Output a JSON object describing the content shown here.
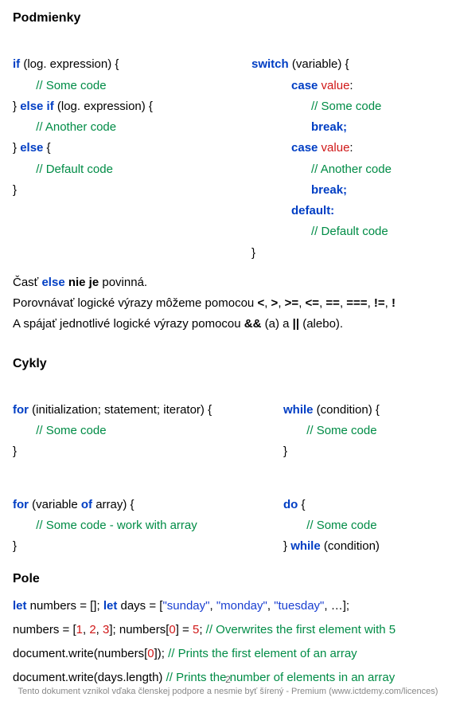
{
  "h_conditions": "Podmienky",
  "if_kw1": "if",
  "if_t1": " (log. expression) {",
  "if_c1": "// Some code",
  "if_kw2": "else if",
  "if_t2a": "} ",
  "if_t2b": " (log. expression) {",
  "if_c2": "// Another code",
  "if_t3a": "} ",
  "if_kw3": "else",
  "if_t3b": " {",
  "if_c3": "// Default code",
  "if_t4": "}",
  "sw_kw": "switch",
  "sw_t1": " (variable) {",
  "sw_case": "case",
  "sw_val1": " value",
  "sw_colon": ":",
  "sw_c1": "// Some code",
  "sw_break": "break;",
  "sw_c2": "// Another code",
  "sw_def": "default:",
  "sw_c3": "// Default code",
  "sw_end": "}",
  "para1_a": "Časť ",
  "para1_kw": "else",
  "para1_b": " nie je",
  "para1_c": " povinná.",
  "para2_a": "Porovnávať logické výrazy môžeme pomocou ",
  "para2_b": "<",
  "para2_s1": ", ",
  "para2_c": ">",
  "para2_s2": ", ",
  "para2_d": ">=",
  "para2_s3": ", ",
  "para2_e": "<=",
  "para2_s4": ", ",
  "para2_f": "==",
  "para2_s5": ", ",
  "para2_g": "===",
  "para2_s6": ", ",
  "para2_h": "!=",
  "para2_s7": ", ",
  "para2_i": "!",
  "para3_a": "A spájať jednotlivé logické výrazy pomocou ",
  "para3_b": "&&",
  "para3_c": " (a) a ",
  "para3_d": "||",
  "para3_e": " (alebo).",
  "h_loops": "Cykly",
  "for_kw": "for",
  "for_t1": " (initialization; statement; iterator) {",
  "for_c1": "// Some code",
  "for_end": "}",
  "while_kw": "while",
  "while_t1": " (condition) {",
  "while_c1": "// Some code",
  "while_end": "}",
  "fof_kw1": "for",
  "fof_t1": " (variable ",
  "fof_kw2": "of",
  "fof_t2": " array) {",
  "fof_c1": "// Some code - work with array",
  "fof_end": "}",
  "do_kw": "do",
  "do_t1": " {",
  "do_c1": "// Some code",
  "do_t2a": "} ",
  "do_kw2": "while",
  "do_t2b": " (condition)",
  "h_arrays": "Pole",
  "arr1_let1": " let",
  "arr1_a": " numbers = []; ",
  "arr1_let2": "let",
  "arr1_b": " days = [",
  "arr1_s1": "\"sunday\"",
  "arr1_c1": ", ",
  "arr1_s2": "\"monday\"",
  "arr1_c2": ", ",
  "arr1_s3": "\"tuesday\"",
  "arr1_c3": ", …];",
  "arr2_a": " numbers = [",
  "arr2_n1": "1",
  "arr2_c1": ", ",
  "arr2_n2": "2",
  "arr2_c2": ", ",
  "arr2_n3": "3",
  "arr2_b": "]; numbers[",
  "arr2_n4": "0",
  "arr2_c": "] = ",
  "arr2_n5": "5",
  "arr2_d": ";   ",
  "arr2_cmt": "// Overwrites the first element with 5",
  "arr3_a": " document.write(numbers[",
  "arr3_n1": "0",
  "arr3_b": "]); ",
  "arr3_cmt": "// Prints the first element of an array",
  "arr4_a": " document.write(days.length) ",
  "arr4_cmt": "// Prints the number of elements in an array",
  "page_num": "2",
  "footer": "Tento dokument vznikol vďaka členskej podpore a nesmie byť šírený - Premium (www.ictdemy.com/licences)"
}
